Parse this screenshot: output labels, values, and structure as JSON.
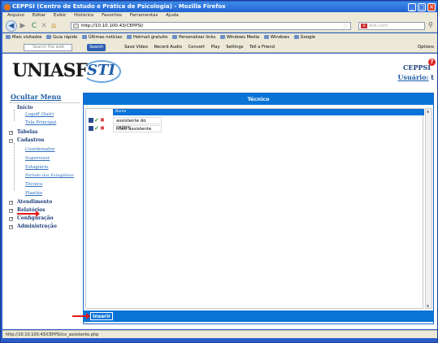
{
  "window": {
    "title": "CEPPSI (Centro de Estudo e Prática de Psicologia) - Mozilla Firefox",
    "min": "_",
    "max": "□",
    "close": "✕"
  },
  "menubar": [
    "Arquivo",
    "Editar",
    "Exibir",
    "Histórico",
    "Favoritos",
    "Ferramentas",
    "Ajuda"
  ],
  "nav": {
    "back": "◀",
    "forward": "▶",
    "reload": "C",
    "stop": "✕",
    "home": "⌂",
    "url": "http://10.10.100.43/CEPPSI/",
    "search_placeholder": "Ask.com",
    "search_go": "⚲"
  },
  "bookmarks": [
    "Mais visitados",
    "Guia rápido",
    "Últimas notícias",
    "Hotmail gratuito",
    "Personalizar links",
    "Windows Media",
    "Windows",
    "Google"
  ],
  "toolbar2": {
    "search_placeholder": "Search the web",
    "search_btn": "Search",
    "items": [
      "Save Video",
      "Record Audio",
      "Convert",
      "Play",
      "Settings",
      "Tell a Friend"
    ],
    "options": "Options"
  },
  "header": {
    "logo_text": "UNIASF",
    "logo2_text": "STI",
    "app_name": "CEPPSI",
    "user_label": "Usuário:",
    "user_value": "t",
    "help": "?"
  },
  "sidebar": {
    "toggle": "Ocultar Menu",
    "inicio": "Início",
    "logoff": "Logoff (Sair)",
    "tela_principal": "Tela Principal",
    "tabelas": "Tabelas",
    "cadastros": "Cadastros",
    "cad_items": [
      "Coordenador",
      "Supervisor",
      "Estagiário",
      "Período dos Estagiários",
      "Técnico",
      "Plantão"
    ],
    "atendimento": "Atendimento",
    "relatorios": "Relatórios",
    "configuracao": "Configuração",
    "administracao": "Administração"
  },
  "content": {
    "title": "Técnico",
    "column_header": "Nome",
    "rows": [
      {
        "name": "assistente do ceppsi"
      },
      {
        "name": "novo assistente"
      }
    ],
    "insert_button": "Inserir"
  },
  "status": "http://10.10.100.43/CEPPSI/cx_assistente.php"
}
